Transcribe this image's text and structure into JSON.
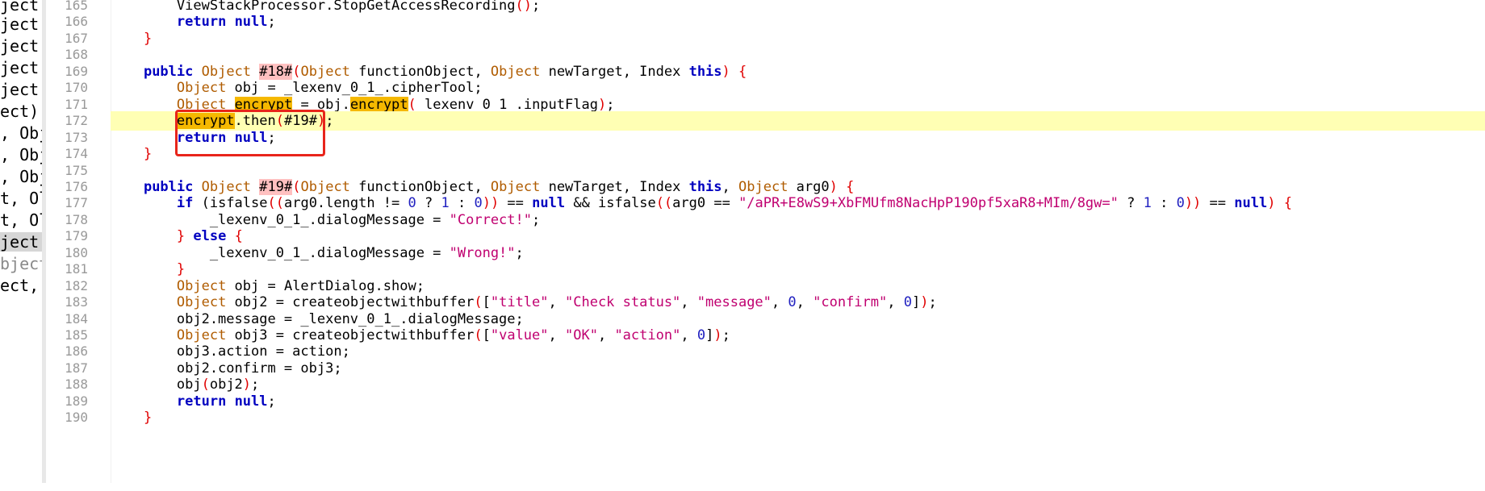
{
  "left_strip": {
    "rows": [
      "ject",
      "ject,",
      "ject,",
      "ject",
      "ject",
      "ect)",
      ", Obj",
      ", Obj",
      ", Obj",
      "t, Ol",
      "t, Ol",
      "ject",
      "bject",
      "ect, "
    ],
    "selected_index": 11
  },
  "code": {
    "current_line": 172,
    "lines": [
      {
        "n": 165,
        "t": [
          [
            "p",
            "        ViewStackProcessor.StopGetAccessRecording"
          ],
          [
            "r",
            "()"
          ],
          [
            "p",
            ";"
          ]
        ]
      },
      {
        "n": 166,
        "t": [
          [
            "p",
            "        "
          ],
          [
            "k",
            "return"
          ],
          [
            "p",
            " "
          ],
          [
            "k",
            "null"
          ],
          [
            "p",
            ";"
          ]
        ]
      },
      {
        "n": 167,
        "t": [
          [
            "p",
            "    "
          ],
          [
            "r",
            "}"
          ]
        ]
      },
      {
        "n": 168,
        "t": []
      },
      {
        "n": 169,
        "t": [
          [
            "p",
            "    "
          ],
          [
            "k",
            "public"
          ],
          [
            "p",
            " "
          ],
          [
            "y",
            "Object"
          ],
          [
            "p",
            " "
          ],
          [
            "h",
            "#18#"
          ],
          [
            "r",
            "("
          ],
          [
            "y",
            "Object"
          ],
          [
            "p",
            " functionObject, "
          ],
          [
            "y",
            "Object"
          ],
          [
            "p",
            " newTarget, Index "
          ],
          [
            "k",
            "this"
          ],
          [
            "r",
            ")"
          ],
          [
            "p",
            " "
          ],
          [
            "r",
            "{"
          ]
        ]
      },
      {
        "n": 170,
        "t": [
          [
            "p",
            "        "
          ],
          [
            "y",
            "Object"
          ],
          [
            "p",
            " obj = _lexenv_0_1_.cipherTool;"
          ]
        ]
      },
      {
        "n": 171,
        "t": [
          [
            "p",
            "        "
          ],
          [
            "y",
            "Object"
          ],
          [
            "p",
            " "
          ],
          [
            "o",
            "encrypt"
          ],
          [
            "p",
            " = obj."
          ],
          [
            "o",
            "encrypt"
          ],
          [
            "r",
            "("
          ],
          [
            "p",
            "_lexenv_0_1_.inputFlag"
          ],
          [
            "r",
            ")"
          ],
          [
            "p",
            ";"
          ]
        ]
      },
      {
        "n": 172,
        "t": [
          [
            "p",
            "        "
          ],
          [
            "o",
            "encrypt"
          ],
          [
            "p",
            ".then"
          ],
          [
            "r",
            "("
          ],
          [
            "p",
            "#19#"
          ],
          [
            "r",
            ")"
          ],
          [
            "p",
            ";"
          ]
        ]
      },
      {
        "n": 173,
        "t": [
          [
            "p",
            "        "
          ],
          [
            "k",
            "return"
          ],
          [
            "p",
            " "
          ],
          [
            "k",
            "null"
          ],
          [
            "p",
            ";"
          ]
        ]
      },
      {
        "n": 174,
        "t": [
          [
            "p",
            "    "
          ],
          [
            "r",
            "}"
          ]
        ]
      },
      {
        "n": 175,
        "t": []
      },
      {
        "n": 176,
        "t": [
          [
            "p",
            "    "
          ],
          [
            "k",
            "public"
          ],
          [
            "p",
            " "
          ],
          [
            "y",
            "Object"
          ],
          [
            "p",
            " "
          ],
          [
            "h",
            "#19#"
          ],
          [
            "r",
            "("
          ],
          [
            "y",
            "Object"
          ],
          [
            "p",
            " functionObject, "
          ],
          [
            "y",
            "Object"
          ],
          [
            "p",
            " newTarget, Index "
          ],
          [
            "k",
            "this"
          ],
          [
            "p",
            ", "
          ],
          [
            "y",
            "Object"
          ],
          [
            "p",
            " arg0"
          ],
          [
            "r",
            ")"
          ],
          [
            "p",
            " "
          ],
          [
            "r",
            "{"
          ]
        ]
      },
      {
        "n": 177,
        "t": [
          [
            "p",
            "        "
          ],
          [
            "k",
            "if"
          ],
          [
            "p",
            " (isfalse"
          ],
          [
            "r",
            "(("
          ],
          [
            "p",
            "arg0.length != "
          ],
          [
            "n",
            "0"
          ],
          [
            "p",
            " ? "
          ],
          [
            "n",
            "1"
          ],
          [
            "p",
            " : "
          ],
          [
            "n",
            "0"
          ],
          [
            "r",
            "))"
          ],
          [
            "p",
            " == "
          ],
          [
            "k",
            "null"
          ],
          [
            "p",
            " && isfalse"
          ],
          [
            "r",
            "(("
          ],
          [
            "p",
            "arg0 == "
          ],
          [
            "s",
            "\"/aPR+E8wS9+XbFMUfm8NacHpP190pf5xaR8+MIm/8gw=\""
          ],
          [
            "p",
            " ? "
          ],
          [
            "n",
            "1"
          ],
          [
            "p",
            " : "
          ],
          [
            "n",
            "0"
          ],
          [
            "r",
            "))"
          ],
          [
            "p",
            " == "
          ],
          [
            "k",
            "null"
          ],
          [
            "r",
            ")"
          ],
          [
            "p",
            " "
          ],
          [
            "r",
            "{"
          ]
        ]
      },
      {
        "n": 178,
        "t": [
          [
            "p",
            "            _lexenv_0_1_.dialogMessage = "
          ],
          [
            "s",
            "\"Correct!\""
          ],
          [
            "p",
            ";"
          ]
        ]
      },
      {
        "n": 179,
        "t": [
          [
            "p",
            "        "
          ],
          [
            "r",
            "}"
          ],
          [
            "p",
            " "
          ],
          [
            "k",
            "else"
          ],
          [
            "p",
            " "
          ],
          [
            "r",
            "{"
          ]
        ]
      },
      {
        "n": 180,
        "t": [
          [
            "p",
            "            _lexenv_0_1_.dialogMessage = "
          ],
          [
            "s",
            "\"Wrong!\""
          ],
          [
            "p",
            ";"
          ]
        ]
      },
      {
        "n": 181,
        "t": [
          [
            "p",
            "        "
          ],
          [
            "r",
            "}"
          ]
        ]
      },
      {
        "n": 182,
        "t": [
          [
            "p",
            "        "
          ],
          [
            "y",
            "Object"
          ],
          [
            "p",
            " obj = AlertDialog.show;"
          ]
        ]
      },
      {
        "n": 183,
        "t": [
          [
            "p",
            "        "
          ],
          [
            "y",
            "Object"
          ],
          [
            "p",
            " obj2 = createobjectwithbuffer"
          ],
          [
            "r",
            "("
          ],
          [
            "p",
            "["
          ],
          [
            "s",
            "\"title\""
          ],
          [
            "p",
            ", "
          ],
          [
            "s",
            "\"Check status\""
          ],
          [
            "p",
            ", "
          ],
          [
            "s",
            "\"message\""
          ],
          [
            "p",
            ", "
          ],
          [
            "n",
            "0"
          ],
          [
            "p",
            ", "
          ],
          [
            "s",
            "\"confirm\""
          ],
          [
            "p",
            ", "
          ],
          [
            "n",
            "0"
          ],
          [
            "p",
            "]"
          ],
          [
            "r",
            ")"
          ],
          [
            "p",
            ";"
          ]
        ]
      },
      {
        "n": 184,
        "t": [
          [
            "p",
            "        obj2.message = _lexenv_0_1_.dialogMessage;"
          ]
        ]
      },
      {
        "n": 185,
        "t": [
          [
            "p",
            "        "
          ],
          [
            "y",
            "Object"
          ],
          [
            "p",
            " obj3 = createobjectwithbuffer"
          ],
          [
            "r",
            "("
          ],
          [
            "p",
            "["
          ],
          [
            "s",
            "\"value\""
          ],
          [
            "p",
            ", "
          ],
          [
            "s",
            "\"OK\""
          ],
          [
            "p",
            ", "
          ],
          [
            "s",
            "\"action\""
          ],
          [
            "p",
            ", "
          ],
          [
            "n",
            "0"
          ],
          [
            "p",
            "]"
          ],
          [
            "r",
            ")"
          ],
          [
            "p",
            ";"
          ]
        ]
      },
      {
        "n": 186,
        "t": [
          [
            "p",
            "        obj3.action = action;"
          ]
        ]
      },
      {
        "n": 187,
        "t": [
          [
            "p",
            "        obj2.confirm = obj3;"
          ]
        ]
      },
      {
        "n": 188,
        "t": [
          [
            "p",
            "        obj"
          ],
          [
            "r",
            "("
          ],
          [
            "p",
            "obj2"
          ],
          [
            "r",
            ")"
          ],
          [
            "p",
            ";"
          ]
        ]
      },
      {
        "n": 189,
        "t": [
          [
            "p",
            "        "
          ],
          [
            "k",
            "return"
          ],
          [
            "p",
            " "
          ],
          [
            "k",
            "null"
          ],
          [
            "p",
            ";"
          ]
        ]
      },
      {
        "n": 190,
        "t": [
          [
            "p",
            "    "
          ],
          [
            "r",
            "}"
          ]
        ]
      }
    ]
  },
  "colors": {
    "keyword": "#0000c0",
    "type": "#b05c00",
    "string": "#c00070",
    "number": "#2020c0",
    "paren": "#e00000",
    "occurrence_highlight": "#f5b800",
    "identifier_highlight": "#ffc0c0",
    "current_line": "#ffffb4",
    "annotation_box": "#e8251b"
  }
}
